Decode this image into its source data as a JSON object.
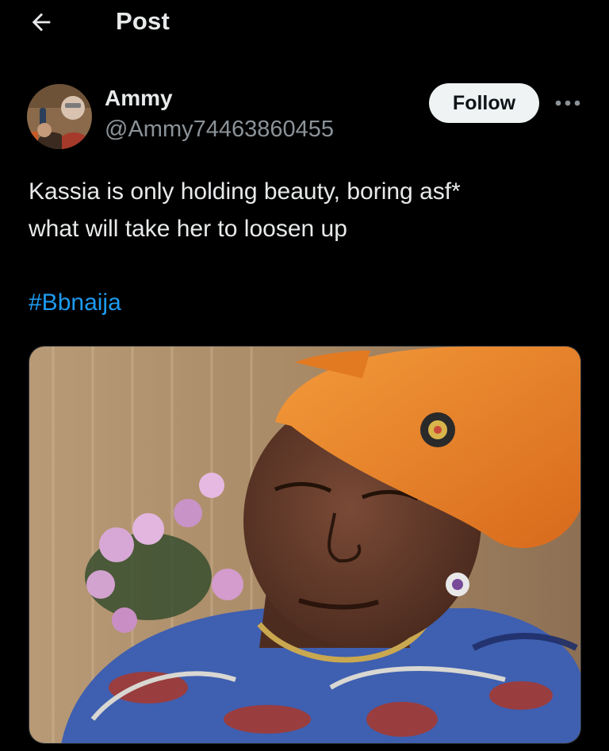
{
  "header": {
    "back_icon": "arrow-left-icon",
    "title": "Post"
  },
  "author": {
    "name": "Ammy",
    "handle": "@Ammy74463860455",
    "avatar_icon": "avatar-photo"
  },
  "actions": {
    "follow_label": "Follow",
    "more_icon": "more-horizontal-icon"
  },
  "post": {
    "text_lines": [
      "Kassia is only holding beauty, boring asf*",
      "what will take her to loosen up"
    ],
    "hashtag": "#Bbnaija"
  },
  "media": {
    "kind": "photo"
  },
  "colors": {
    "background": "#000000",
    "text": "#e7e9ea",
    "secondary_text": "#8b9298",
    "link": "#1d9bf0",
    "follow_button_bg": "#eff3f4",
    "follow_button_text": "#0f1419"
  }
}
